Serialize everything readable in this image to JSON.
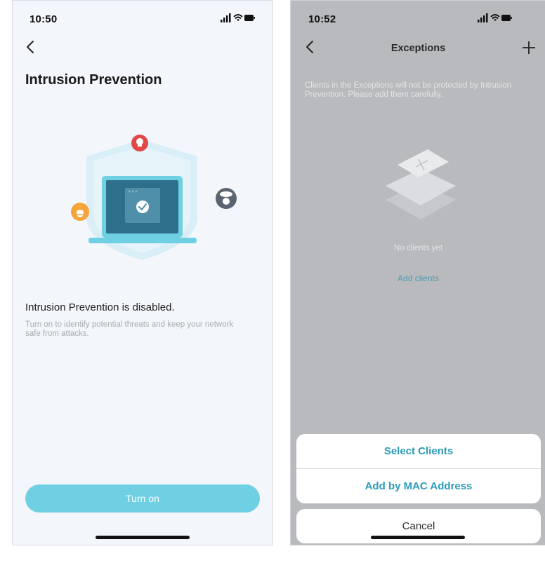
{
  "left_screen": {
    "status": {
      "time": "10:50"
    },
    "title": "Intrusion Prevention",
    "status_heading": "Intrusion Prevention is disabled.",
    "description": "Turn on to identify potential threats and keep your network safe from attacks.",
    "turn_on_label": "Turn on",
    "icons": {
      "back": "chevron-left-icon",
      "threat_top": "skull-icon",
      "threat_left": "bug-icon",
      "threat_right": "spy-icon",
      "center": "checkmark-icon"
    },
    "colors": {
      "background": "#f3f6fa",
      "accent": "#6fd0e4",
      "skull": "#e14848",
      "bug": "#f3a53c",
      "spy": "#5b6570"
    }
  },
  "right_screen": {
    "status": {
      "time": "10:52"
    },
    "nav_title": "Exceptions",
    "info_text": "Clients in the Exceptions will not be protected by Intrusion Prevention. Please add them carefully.",
    "empty_text": "No clients yet",
    "add_clients_link": "Add clients",
    "action_sheet": {
      "options": [
        "Select Clients",
        "Add by MAC Address"
      ],
      "cancel": "Cancel"
    },
    "icons": {
      "back": "chevron-left-icon",
      "add": "plus-icon"
    },
    "colors": {
      "overlay": "#b9babd",
      "link": "#2a9bb8"
    }
  }
}
